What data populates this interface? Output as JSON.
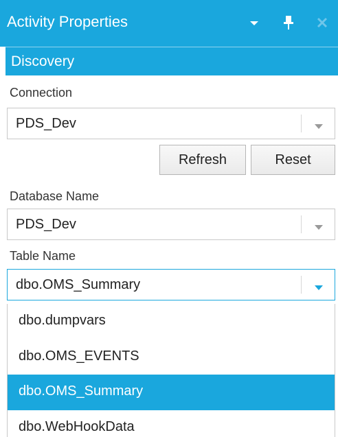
{
  "window": {
    "title": "Activity Properties",
    "dropdown_icon": "dropdown-arrow-icon",
    "pin_icon": "pin-icon",
    "close_icon": "close-icon"
  },
  "section": {
    "title": "Discovery"
  },
  "connection": {
    "label": "Connection",
    "value": "PDS_Dev"
  },
  "buttons": {
    "refresh": "Refresh",
    "reset": "Reset"
  },
  "database": {
    "label": "Database Name",
    "value": "PDS_Dev"
  },
  "table": {
    "label": "Table Name",
    "value": "dbo.OMS_Summary",
    "options": [
      "dbo.dumpvars",
      "dbo.OMS_EVENTS",
      "dbo.OMS_Summary",
      "dbo.WebHookData"
    ],
    "selected_index": 2
  },
  "colors": {
    "accent": "#1aa7dd",
    "border": "#c8c8c8",
    "text": "#222222"
  }
}
